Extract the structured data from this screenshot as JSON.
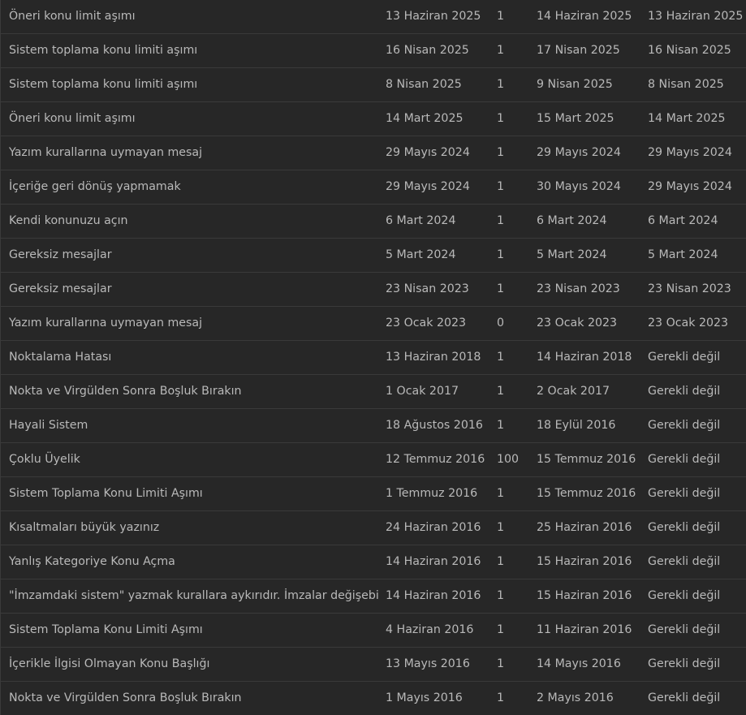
{
  "warnings": {
    "rows": [
      {
        "reason": "Öneri konu limit aşımı",
        "date": "13 Haziran 2025",
        "points": "1",
        "expiry": "14 Haziran 2025",
        "removal": "13 Haziran 2025"
      },
      {
        "reason": "Sistem toplama konu limiti aşımı",
        "date": "16 Nisan 2025",
        "points": "1",
        "expiry": "17 Nisan 2025",
        "removal": "16 Nisan 2025"
      },
      {
        "reason": "Sistem toplama konu limiti aşımı",
        "date": "8 Nisan 2025",
        "points": "1",
        "expiry": "9 Nisan 2025",
        "removal": "8 Nisan 2025"
      },
      {
        "reason": "Öneri konu limit aşımı",
        "date": "14 Mart 2025",
        "points": "1",
        "expiry": "15 Mart 2025",
        "removal": "14 Mart 2025"
      },
      {
        "reason": "Yazım kurallarına uymayan mesaj",
        "date": "29 Mayıs 2024",
        "points": "1",
        "expiry": "29 Mayıs 2024",
        "removal": "29 Mayıs 2024"
      },
      {
        "reason": "İçeriğe geri dönüş yapmamak",
        "date": "29 Mayıs 2024",
        "points": "1",
        "expiry": "30 Mayıs 2024",
        "removal": "29 Mayıs 2024"
      },
      {
        "reason": "Kendi konunuzu açın",
        "date": "6 Mart 2024",
        "points": "1",
        "expiry": "6 Mart 2024",
        "removal": "6 Mart 2024"
      },
      {
        "reason": "Gereksiz mesajlar",
        "date": "5 Mart 2024",
        "points": "1",
        "expiry": "5 Mart 2024",
        "removal": "5 Mart 2024"
      },
      {
        "reason": "Gereksiz mesajlar",
        "date": "23 Nisan 2023",
        "points": "1",
        "expiry": "23 Nisan 2023",
        "removal": "23 Nisan 2023"
      },
      {
        "reason": "Yazım kurallarına uymayan mesaj",
        "date": "23 Ocak 2023",
        "points": "0",
        "expiry": "23 Ocak 2023",
        "removal": "23 Ocak 2023"
      },
      {
        "reason": "Noktalama Hatası",
        "date": "13 Haziran 2018",
        "points": "1",
        "expiry": "14 Haziran 2018",
        "removal": "Gerekli değil"
      },
      {
        "reason": "Nokta ve Virgülden Sonra Boşluk Bırakın",
        "date": "1 Ocak 2017",
        "points": "1",
        "expiry": "2 Ocak 2017",
        "removal": "Gerekli değil"
      },
      {
        "reason": "Hayali Sistem",
        "date": "18 Ağustos 2016",
        "points": "1",
        "expiry": "18 Eylül 2016",
        "removal": "Gerekli değil"
      },
      {
        "reason": "Çoklu Üyelik",
        "date": "12 Temmuz 2016",
        "points": "100",
        "expiry": "15 Temmuz 2016",
        "removal": "Gerekli değil"
      },
      {
        "reason": "Sistem Toplama Konu Limiti Aşımı",
        "date": "1 Temmuz 2016",
        "points": "1",
        "expiry": "15 Temmuz 2016",
        "removal": "Gerekli değil"
      },
      {
        "reason": "Kısaltmaları büyük yazınız",
        "date": "24 Haziran 2016",
        "points": "1",
        "expiry": "25 Haziran 2016",
        "removal": "Gerekli değil"
      },
      {
        "reason": "Yanlış Kategoriye Konu Açma",
        "date": "14 Haziran 2016",
        "points": "1",
        "expiry": "15 Haziran 2016",
        "removal": "Gerekli değil"
      },
      {
        "reason": "\"İmzamdaki sistem\" yazmak kurallara aykırıdır. İmzalar değişebilir.",
        "date": "14 Haziran 2016",
        "points": "1",
        "expiry": "15 Haziran 2016",
        "removal": "Gerekli değil"
      },
      {
        "reason": "Sistem Toplama Konu Limiti Aşımı",
        "date": "4 Haziran 2016",
        "points": "1",
        "expiry": "11 Haziran 2016",
        "removal": "Gerekli değil"
      },
      {
        "reason": "İçerikle İlgisi Olmayan Konu Başlığı",
        "date": "13 Mayıs 2016",
        "points": "1",
        "expiry": "14 Mayıs 2016",
        "removal": "Gerekli değil"
      },
      {
        "reason": "Nokta ve Virgülden Sonra Boşluk Bırakın",
        "date": "1 Mayıs 2016",
        "points": "1",
        "expiry": "2 Mayıs 2016",
        "removal": "Gerekli değil"
      }
    ]
  }
}
